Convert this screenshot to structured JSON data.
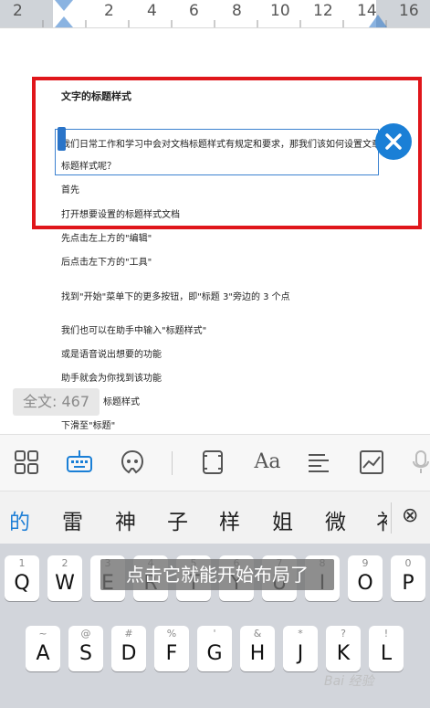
{
  "ruler": {
    "numbers": [
      "2",
      "2",
      "4",
      "6",
      "8",
      "10",
      "12",
      "14",
      "16"
    ]
  },
  "document": {
    "title": "文字的标题样式",
    "lines": [
      "我们日常工作和学习中会对文档标题样式有规定和要求，那我们该如何设置文章",
      "标题样式呢？",
      "首先",
      "打开想要设置的标题样式文档",
      "先点击左上方的\"编辑\"",
      "后点击左下方的\"工具\"",
      "找到\"开始\"菜单下的更多按钮，即\"标题 3\"旁边的 3 个点",
      "我们也可以在助手中输入\"标题样式\"",
      "或是语音说出想要的功能",
      "助手就会为你找到该功能",
      "标题样式",
      "下滑至\"标题\""
    ],
    "word_count": "全文: 467"
  },
  "toolbar": {
    "icons": [
      "apps-grid-icon",
      "keyboard-icon",
      "assistant-icon",
      "frame-icon",
      "font-icon",
      "align-icon",
      "chart-icon",
      "microphone-icon"
    ]
  },
  "candidates": {
    "words": [
      "的",
      "雷",
      "神",
      "子",
      "样",
      "姐",
      "微",
      "衤"
    ],
    "delete_symbol": "⊗"
  },
  "keyboard": {
    "row1": [
      {
        "sup": "1",
        "key": "Q"
      },
      {
        "sup": "2",
        "key": "W"
      },
      {
        "sup": "3",
        "key": "E"
      },
      {
        "sup": "4",
        "key": "R"
      },
      {
        "sup": "5",
        "key": "T"
      },
      {
        "sup": "6",
        "key": "Y"
      },
      {
        "sup": "7",
        "key": "U"
      },
      {
        "sup": "8",
        "key": "I"
      },
      {
        "sup": "9",
        "key": "O"
      },
      {
        "sup": "0",
        "key": "P"
      }
    ],
    "row2": [
      {
        "sup": "~",
        "key": "A"
      },
      {
        "sup": "@",
        "key": "S"
      },
      {
        "sup": "#",
        "key": "D"
      },
      {
        "sup": "%",
        "key": "F"
      },
      {
        "sup": "'",
        "key": "G"
      },
      {
        "sup": "&",
        "key": "H"
      },
      {
        "sup": "*",
        "key": "J"
      },
      {
        "sup": "?",
        "key": "K"
      },
      {
        "sup": "!",
        "key": "L"
      }
    ]
  },
  "overlay": {
    "subtitle": "点击它就能开始布局了",
    "watermark": "Bai 经验"
  },
  "colors": {
    "highlight_red": "#e0161b",
    "accent_blue": "#1a7fd6"
  }
}
